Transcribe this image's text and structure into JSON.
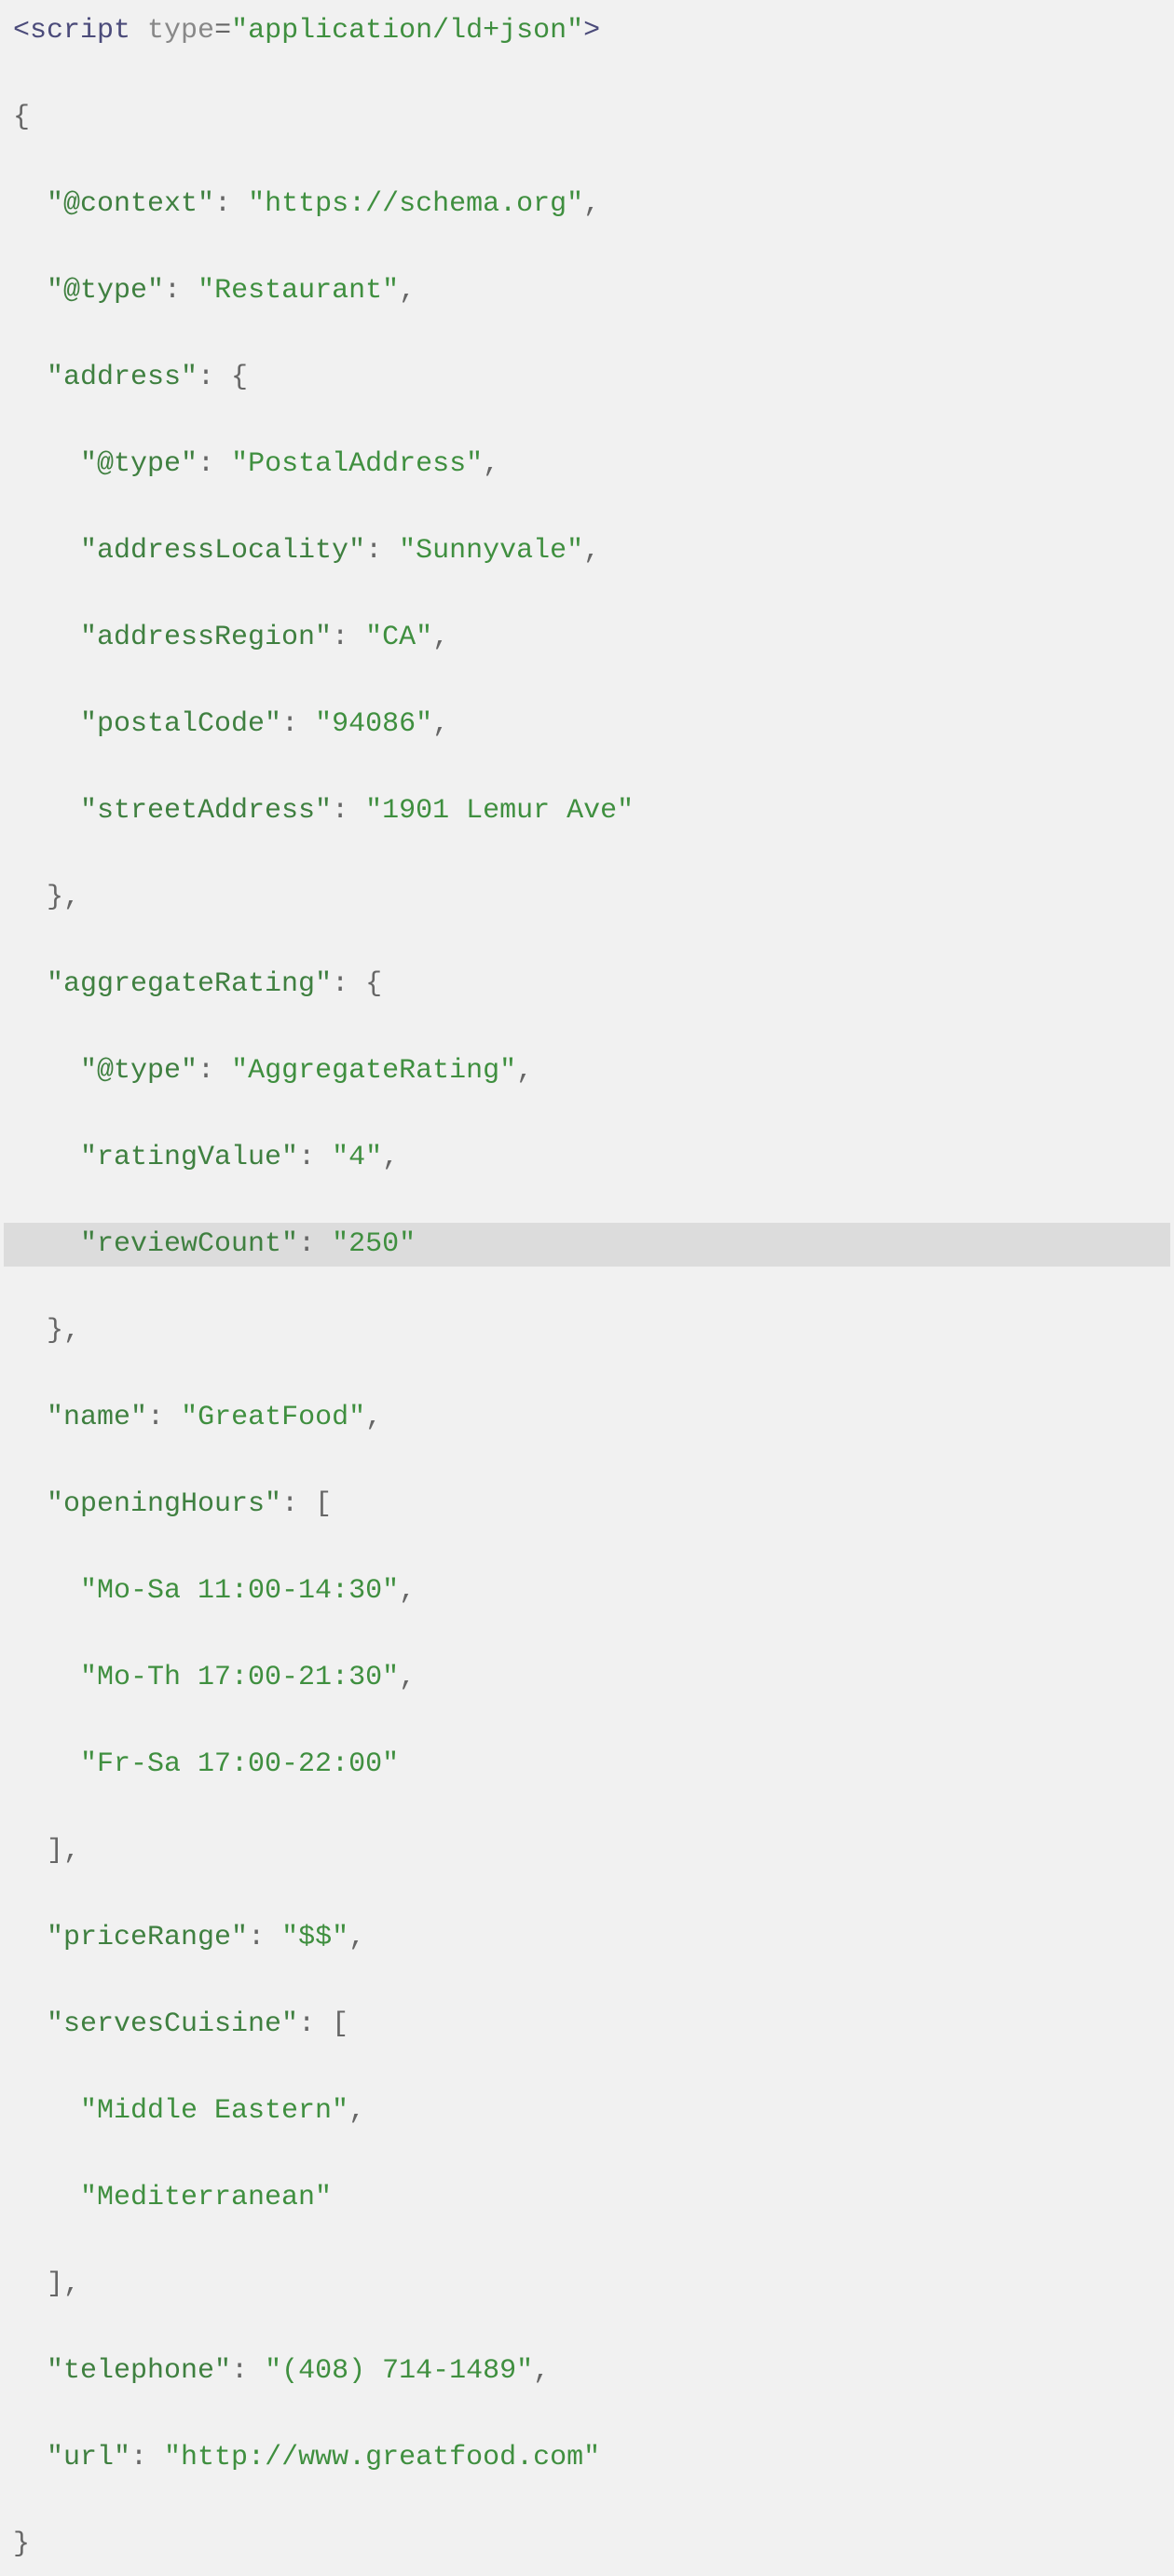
{
  "code": {
    "scriptTag": {
      "open_lt": "<",
      "open_name": "script",
      "attr_name": " type",
      "attr_eq": "=",
      "attr_val": "\"application/ld+json\"",
      "open_gt": ">"
    },
    "lines": [
      {
        "indent": 0,
        "tokens": [
          {
            "t": "punct",
            "v": "{"
          }
        ]
      },
      {
        "indent": 1,
        "tokens": [
          {
            "t": "key",
            "v": "\"@context\""
          },
          {
            "t": "punct",
            "v": ": "
          },
          {
            "t": "str",
            "v": "\"https://schema.org\""
          },
          {
            "t": "punct",
            "v": ","
          }
        ]
      },
      {
        "indent": 1,
        "tokens": [
          {
            "t": "key",
            "v": "\"@type\""
          },
          {
            "t": "punct",
            "v": ": "
          },
          {
            "t": "str",
            "v": "\"Restaurant\""
          },
          {
            "t": "punct",
            "v": ","
          }
        ]
      },
      {
        "indent": 1,
        "tokens": [
          {
            "t": "key",
            "v": "\"address\""
          },
          {
            "t": "punct",
            "v": ": {"
          }
        ]
      },
      {
        "indent": 2,
        "tokens": [
          {
            "t": "key",
            "v": "\"@type\""
          },
          {
            "t": "punct",
            "v": ": "
          },
          {
            "t": "str",
            "v": "\"PostalAddress\""
          },
          {
            "t": "punct",
            "v": ","
          }
        ]
      },
      {
        "indent": 2,
        "tokens": [
          {
            "t": "key",
            "v": "\"addressLocality\""
          },
          {
            "t": "punct",
            "v": ": "
          },
          {
            "t": "str",
            "v": "\"Sunnyvale\""
          },
          {
            "t": "punct",
            "v": ","
          }
        ]
      },
      {
        "indent": 2,
        "tokens": [
          {
            "t": "key",
            "v": "\"addressRegion\""
          },
          {
            "t": "punct",
            "v": ": "
          },
          {
            "t": "str",
            "v": "\"CA\""
          },
          {
            "t": "punct",
            "v": ","
          }
        ]
      },
      {
        "indent": 2,
        "tokens": [
          {
            "t": "key",
            "v": "\"postalCode\""
          },
          {
            "t": "punct",
            "v": ": "
          },
          {
            "t": "str",
            "v": "\"94086\""
          },
          {
            "t": "punct",
            "v": ","
          }
        ]
      },
      {
        "indent": 2,
        "tokens": [
          {
            "t": "key",
            "v": "\"streetAddress\""
          },
          {
            "t": "punct",
            "v": ": "
          },
          {
            "t": "str",
            "v": "\"1901 Lemur Ave\""
          }
        ]
      },
      {
        "indent": 1,
        "tokens": [
          {
            "t": "punct",
            "v": "},"
          }
        ]
      },
      {
        "indent": 1,
        "tokens": [
          {
            "t": "key",
            "v": "\"aggregateRating\""
          },
          {
            "t": "punct",
            "v": ": {"
          }
        ]
      },
      {
        "indent": 2,
        "tokens": [
          {
            "t": "key",
            "v": "\"@type\""
          },
          {
            "t": "punct",
            "v": ": "
          },
          {
            "t": "str",
            "v": "\"AggregateRating\""
          },
          {
            "t": "punct",
            "v": ","
          }
        ]
      },
      {
        "indent": 2,
        "tokens": [
          {
            "t": "key",
            "v": "\"ratingValue\""
          },
          {
            "t": "punct",
            "v": ": "
          },
          {
            "t": "str",
            "v": "\"4\""
          },
          {
            "t": "punct",
            "v": ","
          }
        ]
      },
      {
        "indent": 2,
        "hl": true,
        "tokens": [
          {
            "t": "key",
            "v": "\"reviewCount\""
          },
          {
            "t": "punct",
            "v": ": "
          },
          {
            "t": "str",
            "v": "\"250\""
          }
        ]
      },
      {
        "indent": 1,
        "tokens": [
          {
            "t": "punct",
            "v": "},"
          }
        ]
      },
      {
        "indent": 1,
        "tokens": [
          {
            "t": "key",
            "v": "\"name\""
          },
          {
            "t": "punct",
            "v": ": "
          },
          {
            "t": "str",
            "v": "\"GreatFood\""
          },
          {
            "t": "punct",
            "v": ","
          }
        ]
      },
      {
        "indent": 1,
        "tokens": [
          {
            "t": "key",
            "v": "\"openingHours\""
          },
          {
            "t": "punct",
            "v": ": ["
          }
        ]
      },
      {
        "indent": 2,
        "tokens": [
          {
            "t": "str",
            "v": "\"Mo-Sa 11:00-14:30\""
          },
          {
            "t": "punct",
            "v": ","
          }
        ]
      },
      {
        "indent": 2,
        "tokens": [
          {
            "t": "str",
            "v": "\"Mo-Th 17:00-21:30\""
          },
          {
            "t": "punct",
            "v": ","
          }
        ]
      },
      {
        "indent": 2,
        "tokens": [
          {
            "t": "str",
            "v": "\"Fr-Sa 17:00-22:00\""
          }
        ]
      },
      {
        "indent": 1,
        "tokens": [
          {
            "t": "punct",
            "v": "],"
          }
        ]
      },
      {
        "indent": 1,
        "tokens": [
          {
            "t": "key",
            "v": "\"priceRange\""
          },
          {
            "t": "punct",
            "v": ": "
          },
          {
            "t": "str",
            "v": "\"$$\""
          },
          {
            "t": "punct",
            "v": ","
          }
        ]
      },
      {
        "indent": 1,
        "tokens": [
          {
            "t": "key",
            "v": "\"servesCuisine\""
          },
          {
            "t": "punct",
            "v": ": ["
          }
        ]
      },
      {
        "indent": 2,
        "tokens": [
          {
            "t": "str",
            "v": "\"Middle Eastern\""
          },
          {
            "t": "punct",
            "v": ","
          }
        ]
      },
      {
        "indent": 2,
        "tokens": [
          {
            "t": "str",
            "v": "\"Mediterranean\""
          }
        ]
      },
      {
        "indent": 1,
        "tokens": [
          {
            "t": "punct",
            "v": "],"
          }
        ]
      },
      {
        "indent": 1,
        "tokens": [
          {
            "t": "key",
            "v": "\"telephone\""
          },
          {
            "t": "punct",
            "v": ": "
          },
          {
            "t": "str",
            "v": "\"(408) 714-1489\""
          },
          {
            "t": "punct",
            "v": ","
          }
        ]
      },
      {
        "indent": 1,
        "tokens": [
          {
            "t": "key",
            "v": "\"url\""
          },
          {
            "t": "punct",
            "v": ": "
          },
          {
            "t": "str",
            "v": "\"http://www.greatfood.com\""
          }
        ]
      },
      {
        "indent": 0,
        "tokens": [
          {
            "t": "punct",
            "v": "}"
          }
        ]
      }
    ],
    "indentUnit": "  "
  }
}
